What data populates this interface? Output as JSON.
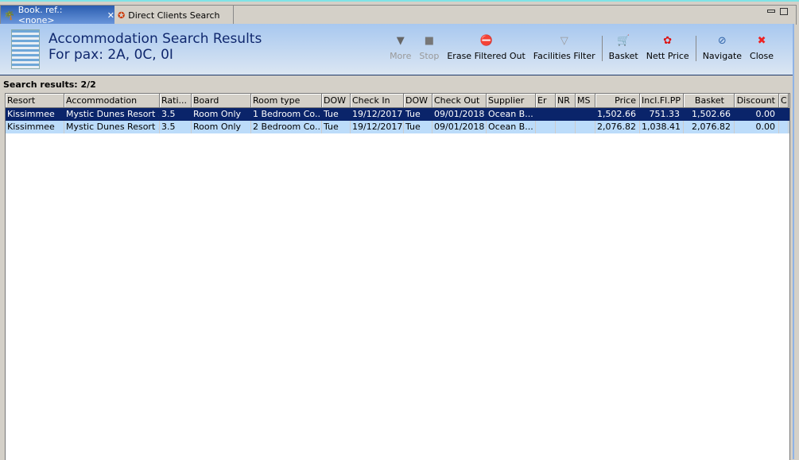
{
  "tabs": [
    {
      "label": "Book. ref.: <none>",
      "close": "✕"
    },
    {
      "label": "Direct Clients Search"
    }
  ],
  "header": {
    "title": "Accommodation Search Results",
    "subtitle": "For pax: 2A, 0C, 0I"
  },
  "toolbar": [
    {
      "label": "More",
      "icon": "▼",
      "disabled": true
    },
    {
      "label": "Stop",
      "icon": "■",
      "disabled": true
    },
    {
      "label": "Erase Filtered Out",
      "icon": "⛔"
    },
    {
      "label": "Facilities Filter",
      "icon": "▽"
    },
    {
      "label": "Basket",
      "icon": "🛒"
    },
    {
      "label": "Nett Price",
      "icon": "✿"
    },
    {
      "label": "Navigate",
      "icon": "⊘"
    },
    {
      "label": "Close",
      "icon": "✖"
    }
  ],
  "search_results": "Search results: 2/2",
  "columns": [
    "Resort",
    "Accommodation",
    "Rati...",
    "Board",
    "Room type",
    "DOW",
    "Check In",
    "DOW",
    "Check Out",
    "Supplier",
    "Er",
    "NR",
    "MS",
    "Price",
    "Incl.Fl.PP",
    "Basket",
    "Discount",
    "C"
  ],
  "rows": [
    [
      "Kissimmee",
      "Mystic Dunes Resort ...",
      "3.5",
      "Room Only",
      "1 Bedroom Co...",
      "Tue",
      "19/12/2017",
      "Tue",
      "09/01/2018",
      "Ocean B...",
      "",
      "",
      "",
      "1,502.66",
      "751.33",
      "1,502.66",
      "0.00",
      ""
    ],
    [
      "Kissimmee",
      "Mystic Dunes Resort ...",
      "3.5",
      "Room Only",
      "2 Bedroom Co...",
      "Tue",
      "19/12/2017",
      "Tue",
      "09/01/2018",
      "Ocean B...",
      "",
      "",
      "",
      "2,076.82",
      "1,038.41",
      "2,076.82",
      "0.00",
      ""
    ]
  ]
}
